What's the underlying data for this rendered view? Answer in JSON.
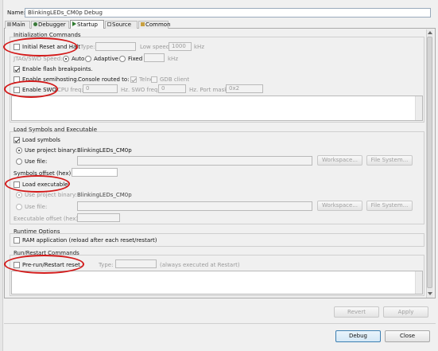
{
  "name": {
    "label": "Name:",
    "value": "BlinkingLEDs_CM0p Debug"
  },
  "tabs": [
    "Main",
    "Debugger",
    "Startup",
    "Source",
    "Common"
  ],
  "init": {
    "title": "Initialization Commands",
    "reset_halt": "Initial Reset and Halt",
    "type_label": "Type:",
    "low_speed_label": "Low speed:",
    "low_speed_value": "1000",
    "khz": "kHz",
    "jtag_label": "JTAG/SWD Speed:",
    "auto": "Auto",
    "adaptive": "Adaptive",
    "fixed": "Fixed",
    "khz2": "kHz",
    "flash_bp": "Enable flash breakpoints.",
    "semihosting": "Enable semihosting.",
    "console_label": "Console routed to:",
    "telnet": "Telnet",
    "gdb_client": "GDB client",
    "swo": "Enable SWO.",
    "cpu_freq_label": "CPU freq:",
    "cpu_freq_value": "0",
    "hz1": "Hz. SWO freq:",
    "swo_freq_value": "0",
    "hz2": "Hz. Port mask:",
    "port_mask_value": "0x2"
  },
  "load": {
    "title": "Load Symbols and Executable",
    "load_symbols": "Load symbols",
    "use_project_binary": "Use project binary:",
    "project_binary": "BlinkingLEDs_CM0p",
    "use_file": "Use file:",
    "workspace": "Workspace...",
    "filesystem": "File System...",
    "symbols_offset": "Symbols offset (hex):",
    "load_executable": "Load executable",
    "use_project_binary2": "Use project binary:",
    "project_binary2": "BlinkingLEDs_CM0p",
    "use_file2": "Use file:",
    "workspace2": "Workspace...",
    "filesystem2": "File System...",
    "exec_offset": "Executable offset (hex):"
  },
  "runtime": {
    "title": "Runtime Options",
    "ram_app": "RAM application (reload after each reset/restart)"
  },
  "runrestart": {
    "title": "Run/Restart Commands",
    "prerun": "Pre-run/Restart reset.",
    "type_label": "Type:",
    "always_note": "(always executed at Restart)"
  },
  "buttons": {
    "revert": "Revert",
    "apply": "Apply",
    "debug": "Debug",
    "close": "Close"
  },
  "colors": {
    "highlight": "#d31a1a"
  }
}
